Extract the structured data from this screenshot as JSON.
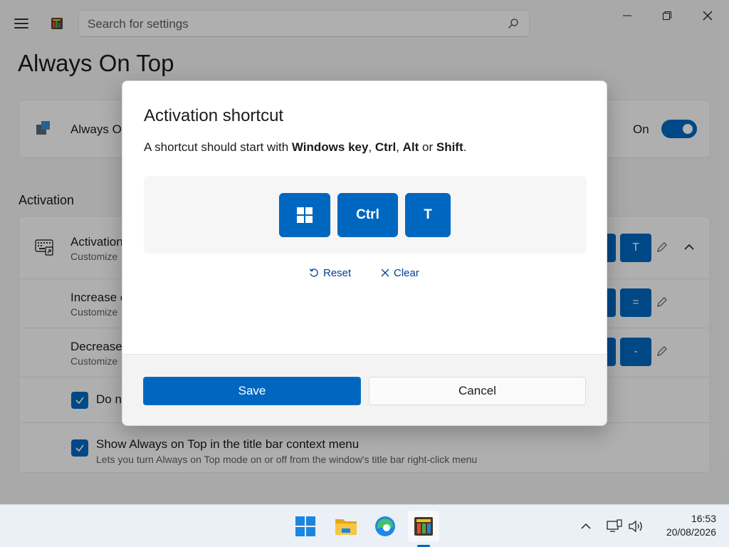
{
  "search": {
    "placeholder": "Search for settings"
  },
  "page": {
    "title": "Always On Top"
  },
  "main_card": {
    "label": "Always O",
    "toggle_state": "On"
  },
  "activation_section": {
    "heading": "Activation",
    "rows": [
      {
        "title": "Activation",
        "desc": "Customize",
        "last_key": "T"
      },
      {
        "title": "Increase o",
        "desc": "Customize",
        "last_key": "="
      },
      {
        "title": "Decrease",
        "desc": "Customize",
        "last_key": "-"
      }
    ],
    "checkbox_partial": {
      "label": "Do n"
    },
    "checkbox_context": {
      "label": "Show Always on Top in the title bar context menu",
      "desc": "Lets you turn Always on Top mode on or off from the window's title bar right-click menu"
    }
  },
  "dialog": {
    "title": "Activation shortcut",
    "desc_prefix": "A shortcut should start with ",
    "desc_key1": "Windows key",
    "desc_sep1": ", ",
    "desc_key2": "Ctrl",
    "desc_sep2": ", ",
    "desc_key3": "Alt",
    "desc_sep3": " or ",
    "desc_key4": "Shift",
    "desc_end": ".",
    "keys": [
      "Ctrl",
      "T"
    ],
    "reset_label": "Reset",
    "clear_label": "Clear",
    "save_label": "Save",
    "cancel_label": "Cancel"
  },
  "taskbar": {
    "time": "16:53",
    "date": "20/08/2026"
  },
  "colors": {
    "accent": "#0067c0",
    "overlay": "rgba(0,0,0,0.3)"
  }
}
